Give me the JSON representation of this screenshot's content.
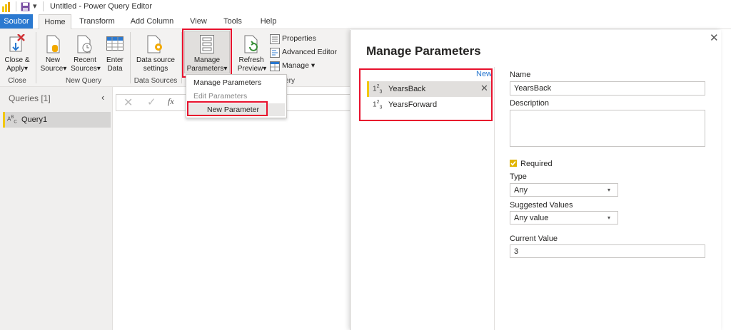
{
  "window": {
    "title": "Untitled - Power Query Editor"
  },
  "tabs": [
    "Soubor",
    "Home",
    "Transform",
    "Add Column",
    "View",
    "Tools",
    "Help"
  ],
  "ribbon": {
    "close_apply": [
      "Close &",
      "Apply"
    ],
    "new_source": [
      "New",
      "Source"
    ],
    "recent_sources": [
      "Recent",
      "Sources"
    ],
    "enter_data": [
      "Enter",
      "Data"
    ],
    "data_source_settings": [
      "Data source",
      "settings"
    ],
    "manage_parameters": [
      "Manage",
      "Parameters"
    ],
    "refresh_preview": [
      "Refresh",
      "Preview"
    ],
    "properties": "Properties",
    "advanced_editor": "Advanced Editor",
    "manage": "Manage",
    "groups": {
      "close": "Close",
      "new_query": "New Query",
      "data_sources": "Data Sources",
      "query_partial": "ery"
    }
  },
  "dropdown": {
    "items": [
      "Manage Parameters",
      "Edit Parameters",
      "New Parameter"
    ]
  },
  "queries": {
    "header": "Queries [1]",
    "items": [
      {
        "type_glyph": "ABC",
        "name": "Query1"
      }
    ]
  },
  "formula_bar": {
    "fx": "fx"
  },
  "dialog": {
    "title": "Manage Parameters",
    "new_link": "New",
    "parameters": [
      {
        "type_glyph": "123",
        "name": "YearsBack",
        "selected": true
      },
      {
        "type_glyph": "123",
        "name": "YearsForward",
        "selected": false
      }
    ],
    "fields": {
      "name_label": "Name",
      "name_value": "YearsBack",
      "description_label": "Description",
      "description_value": "",
      "required_label": "Required",
      "required_checked": true,
      "type_label": "Type",
      "type_value": "Any",
      "suggested_label": "Suggested Values",
      "suggested_value": "Any value",
      "current_label": "Current Value",
      "current_value": "3"
    }
  },
  "colors": {
    "accent": "#2b79d0",
    "highlight": "#e8112d",
    "check": "#e0b400"
  }
}
